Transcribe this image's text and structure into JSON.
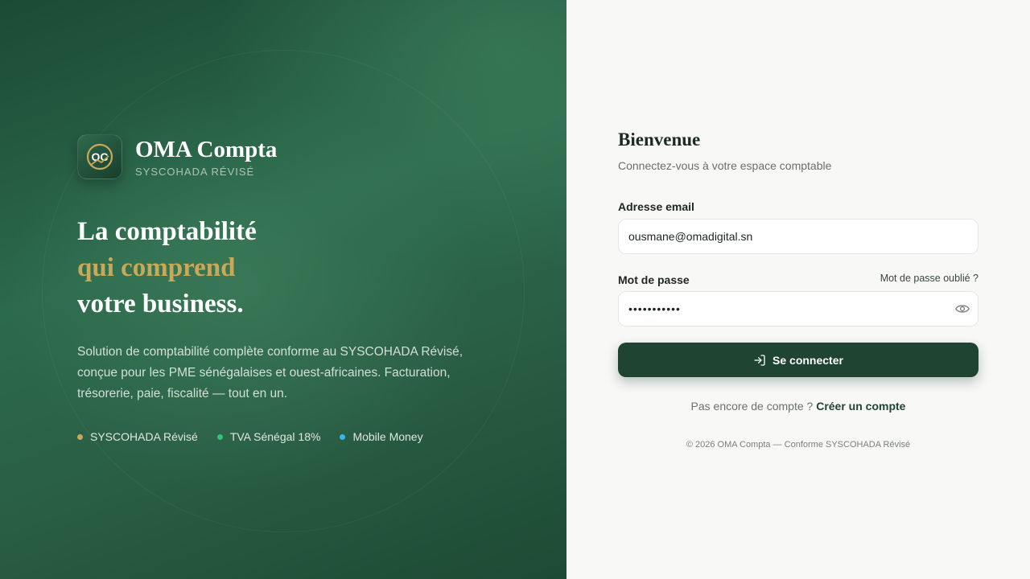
{
  "brand": {
    "name": "OMA Compta",
    "subtitle": "SYSCOHADA RÉVISÉ",
    "logo_text": "OC"
  },
  "hero": {
    "line1": "La comptabilité",
    "line2": "qui comprend",
    "line3": "votre business.",
    "description": "Solution de comptabilité complète conforme au SYSCOHADA Révisé, conçue pour les PME sénégalaises et ouest-africaines. Facturation, trésorerie, paie, fiscalité — tout en un.",
    "tags": [
      {
        "label": "SYSCOHADA Révisé",
        "color": "#c9a858"
      },
      {
        "label": "TVA Sénégal 18%",
        "color": "#34c27a"
      },
      {
        "label": "Mobile Money",
        "color": "#38b6e8"
      }
    ]
  },
  "login": {
    "title": "Bienvenue",
    "subtitle": "Connectez-vous à votre espace comptable",
    "email_label": "Adresse email",
    "email_value": "ousmane@omadigital.sn",
    "password_label": "Mot de passe",
    "password_value": "•••••••••••",
    "forgot_label": "Mot de passe oublié ?",
    "submit_label": "Se connecter",
    "signup_prompt": "Pas encore de compte ?",
    "signup_link": "Créer un compte",
    "footer": "© 2026 OMA Compta — Conforme SYSCOHADA Révisé"
  },
  "colors": {
    "primary": "#1f4432",
    "gold": "#c9a858"
  }
}
